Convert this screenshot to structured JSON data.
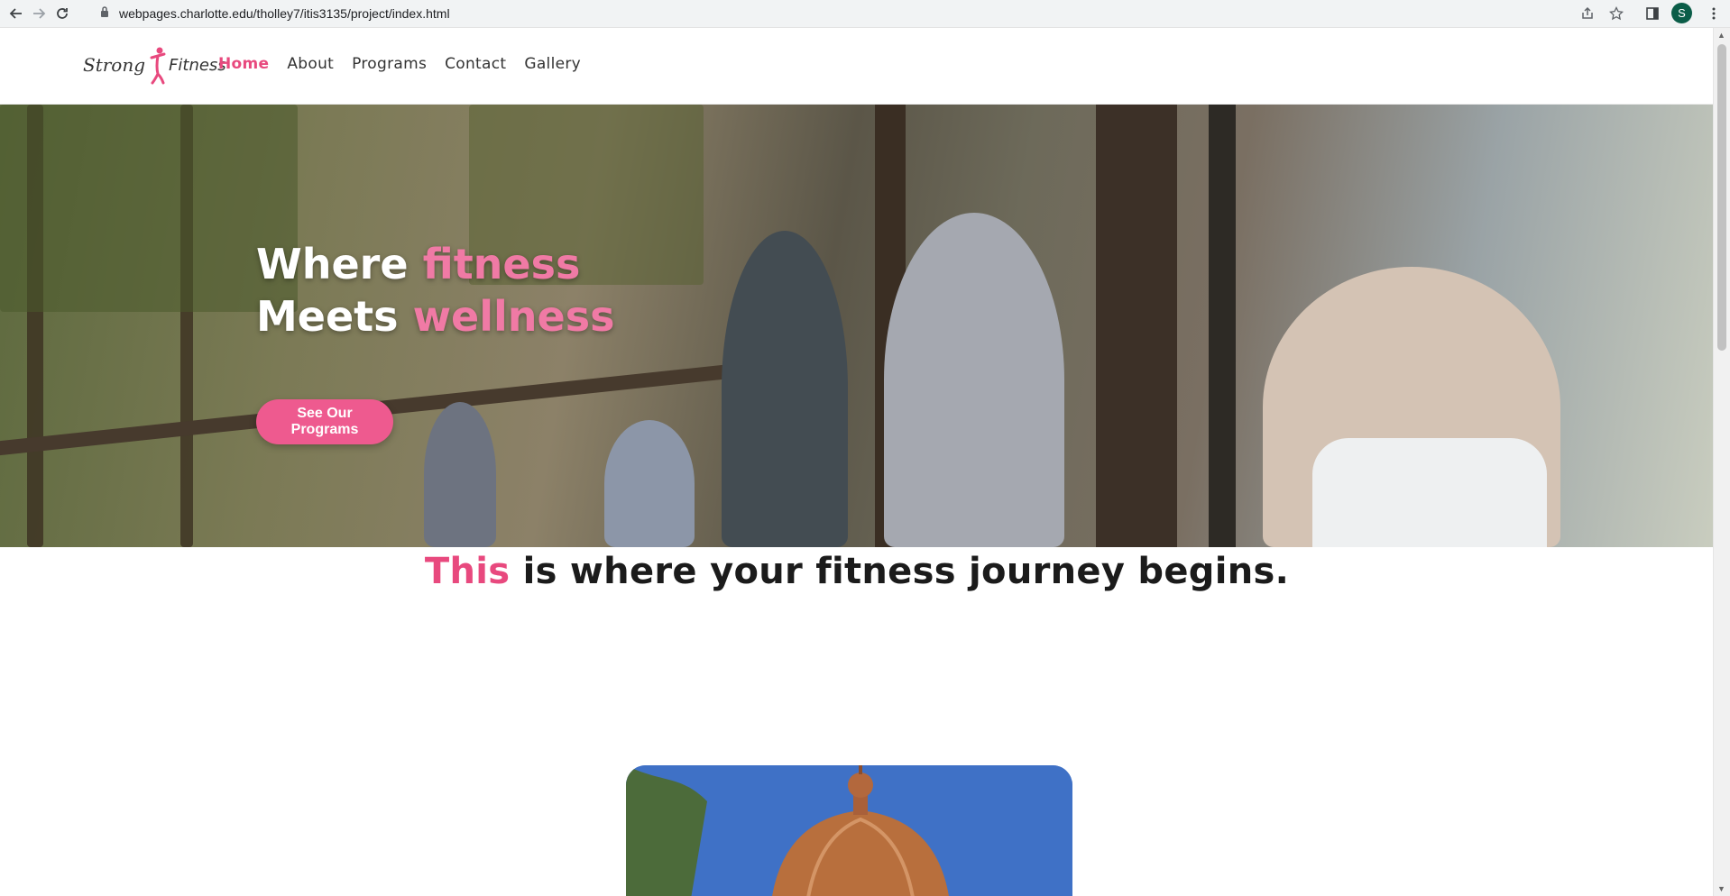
{
  "browser": {
    "url": "webpages.charlotte.edu/tholley7/itis3135/project/index.html",
    "profile_initial": "S"
  },
  "site": {
    "logo": {
      "word1": "Strong",
      "word2": "Fitness"
    },
    "nav": [
      {
        "label": "Home",
        "active": true
      },
      {
        "label": "About",
        "active": false
      },
      {
        "label": "Programs",
        "active": false
      },
      {
        "label": "Contact",
        "active": false
      },
      {
        "label": "Gallery",
        "active": false
      }
    ]
  },
  "hero": {
    "line1_white": "Where",
    "line1_pink": "fitness",
    "line2_white": "Meets",
    "line2_pink": "wellness",
    "button_label": "See Our Programs"
  },
  "journey": {
    "highlight": "This",
    "rest": " is where your fitness journey begins."
  },
  "colors": {
    "accent": "#e8497e",
    "button": "#ee5a8f",
    "hero_pink": "#f07aa5"
  }
}
